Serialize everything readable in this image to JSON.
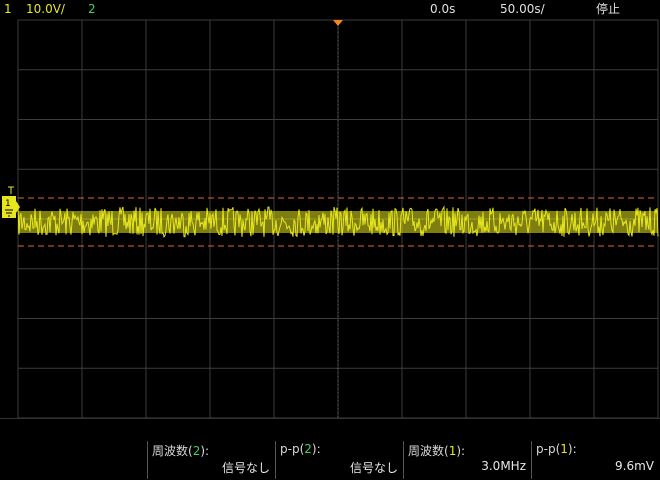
{
  "top_bar": {
    "ch1_number": "1",
    "ch1_scale": "10.0",
    "ch1_scale_unit": "V/",
    "ch2_number": "2",
    "time_position": "0.0s",
    "time_scale": "50.00",
    "time_scale_unit": "s/",
    "run_state": "停止"
  },
  "ch1_marker": "1",
  "measurements": [
    {
      "name": "周波数",
      "channel": "2",
      "value": "信号なし"
    },
    {
      "name": "p-p",
      "channel": "2",
      "value": "信号なし"
    },
    {
      "name": "周波数",
      "channel": "1",
      "value": "3.0MHz"
    },
    {
      "name": "p-p",
      "channel": "1",
      "value": "9.6mV"
    }
  ],
  "colors": {
    "background": "#000000",
    "grid": "#3c3c3c",
    "ch1": "#e6e61e",
    "ch2": "#3fd25a",
    "trigger_marker": "#f08a1e",
    "cursor_line": "#e0603c"
  },
  "grid": {
    "columns": 10,
    "rows": 8
  }
}
